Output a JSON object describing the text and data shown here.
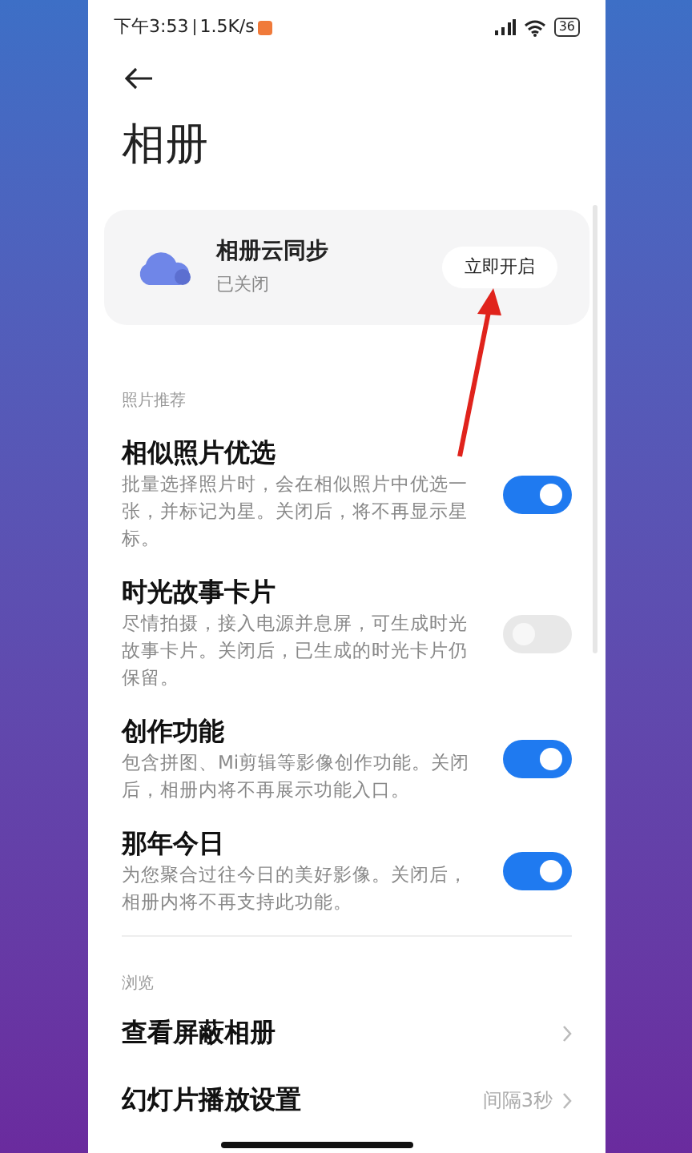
{
  "status_bar": {
    "time": "下午3:53",
    "speed": "1.5K/s",
    "battery": "36"
  },
  "title": "相册",
  "cloud_card": {
    "title": "相册云同步",
    "status": "已关闭",
    "button": "立即开启"
  },
  "sections": [
    {
      "header": "照片推荐",
      "items": [
        {
          "kind": "toggle",
          "title": "相似照片优选",
          "description": "批量选择照片时，会在相似照片中优选一张，并标记为星。关闭后，将不再显示星标。",
          "on": true
        },
        {
          "kind": "toggle",
          "title": "时光故事卡片",
          "description": "尽情拍摄，接入电源并息屏，可生成时光故事卡片。关闭后，已生成的时光卡片仍保留。",
          "on": false
        },
        {
          "kind": "toggle",
          "title": "创作功能",
          "description": "包含拼图、Mi剪辑等影像创作功能。关闭后，相册内将不再展示功能入口。",
          "on": true
        },
        {
          "kind": "toggle",
          "title": "那年今日",
          "description": "为您聚合过往今日的美好影像。关闭后，相册内将不再支持此功能。",
          "on": true
        }
      ]
    },
    {
      "header": "浏览",
      "items": [
        {
          "kind": "link",
          "title": "查看屏蔽相册"
        },
        {
          "kind": "link",
          "title": "幻灯片播放设置",
          "value": "间隔3秒"
        }
      ]
    }
  ]
}
